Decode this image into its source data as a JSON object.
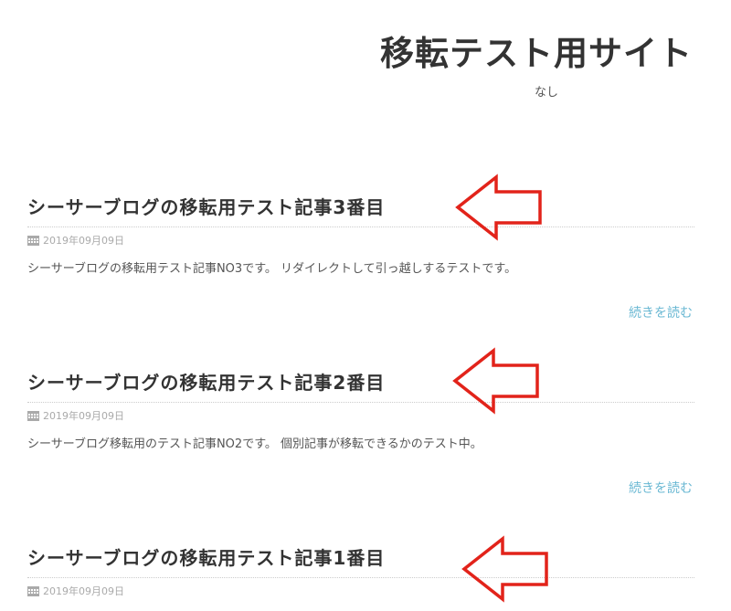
{
  "site": {
    "title": "移転テスト用サイト",
    "description": "なし"
  },
  "colors": {
    "text": "#333333",
    "meta": "#aaaaaa",
    "link": "#6ab8d3",
    "arrow": "#e2231a"
  },
  "icons": {
    "date": "calendar-icon",
    "annotation": "left-arrow-icon"
  },
  "posts": [
    {
      "title": "シーサーブログの移転用テスト記事3番目",
      "date": "2019年09月09日",
      "excerpt": "シーサーブログの移転用テスト記事NO3です。 リダイレクトして引っ越しするテストです。",
      "read_more": "続きを読む"
    },
    {
      "title": "シーサーブログの移転用テスト記事2番目",
      "date": "2019年09月09日",
      "excerpt": "シーサーブログ移転用のテスト記事NO2です。 個別記事が移転できるかのテスト中。",
      "read_more": "続きを読む"
    },
    {
      "title": "シーサーブログの移転用テスト記事1番目",
      "date": "2019年09月09日"
    }
  ]
}
